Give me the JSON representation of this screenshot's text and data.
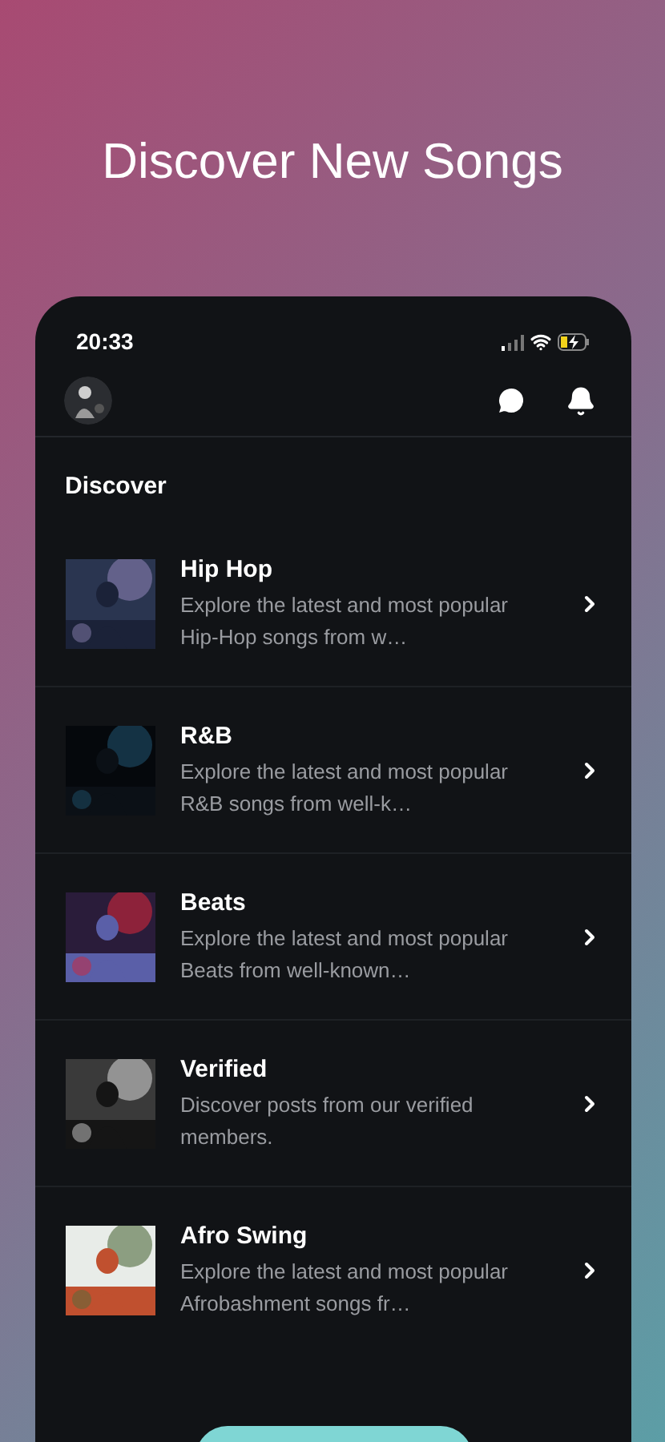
{
  "headline": "Discover New Songs",
  "status_bar": {
    "time": "20:33"
  },
  "section_title": "Discover",
  "categories": [
    {
      "title": "Hip Hop",
      "description": "Explore the latest and most popular Hip-Hop songs from w…"
    },
    {
      "title": "R&B",
      "description": "Explore the latest and most popular R&B songs from well-k…"
    },
    {
      "title": "Beats",
      "description": "Explore the latest and most popular Beats from well-known…"
    },
    {
      "title": "Verified",
      "description": "Discover posts from our verified members."
    },
    {
      "title": "Afro Swing",
      "description": "Explore the latest and most popular Afrobashment songs fr…"
    }
  ]
}
